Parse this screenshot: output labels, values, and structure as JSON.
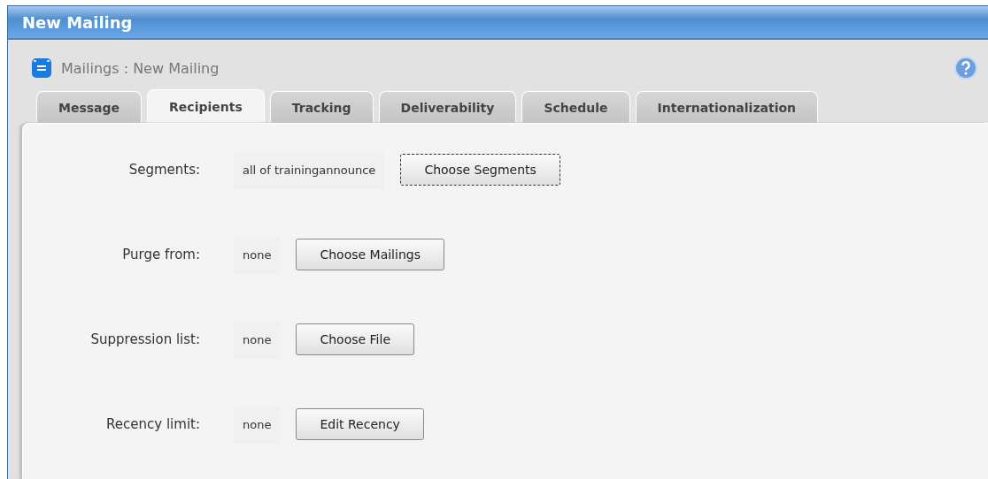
{
  "window": {
    "title": "New Mailing"
  },
  "breadcrumb": "Mailings : New Mailing",
  "tabs": [
    {
      "label": "Message",
      "selected": false
    },
    {
      "label": "Recipients",
      "selected": true
    },
    {
      "label": "Tracking",
      "selected": false
    },
    {
      "label": "Deliverability",
      "selected": false
    },
    {
      "label": "Schedule",
      "selected": false
    },
    {
      "label": "Internationalization",
      "selected": false
    }
  ],
  "fields": [
    {
      "label": "Segments:",
      "value": "all of trainingannounce",
      "button": "Choose Segments",
      "focused": true
    },
    {
      "label": "Purge from:",
      "value": "none",
      "button": "Choose Mailings",
      "focused": false
    },
    {
      "label": "Suppression list:",
      "value": "none",
      "button": "Choose File",
      "focused": false
    },
    {
      "label": "Recency limit:",
      "value": "none",
      "button": "Edit Recency",
      "focused": false
    }
  ]
}
